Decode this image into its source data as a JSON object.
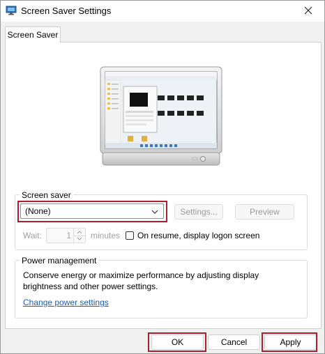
{
  "window": {
    "title": "Screen Saver Settings",
    "app_icon": "display-settings-icon",
    "close_icon": "close-icon"
  },
  "tabs": [
    {
      "label": "Screen Saver",
      "selected": true
    }
  ],
  "preview_monitor": {
    "icon": "monitor-preview-icon"
  },
  "screen_saver": {
    "group_label": "Screen saver",
    "selected": "(None)",
    "settings_label": "Settings...",
    "preview_label": "Preview",
    "wait_label": "Wait:",
    "wait_value": "1",
    "minutes_label": "minutes",
    "resume_label": "On resume, display logon screen",
    "resume_checked": false
  },
  "power_management": {
    "group_label": "Power management",
    "description": "Conserve energy or maximize performance by adjusting display brightness and other power settings.",
    "link_label": "Change power settings"
  },
  "footer": {
    "ok_label": "OK",
    "cancel_label": "Cancel",
    "apply_label": "Apply"
  },
  "colors": {
    "highlight_outline": "#b01c2e",
    "link": "#1a5fb4"
  }
}
